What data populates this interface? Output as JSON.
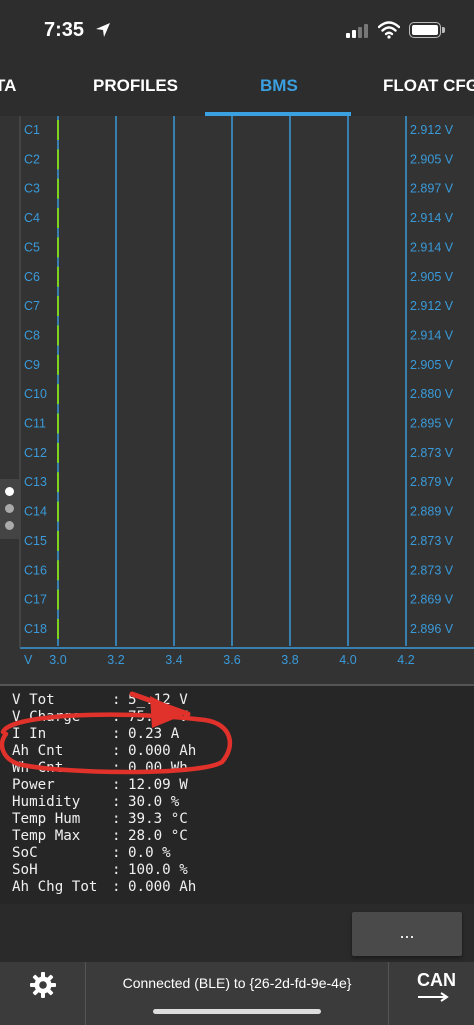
{
  "status_bar": {
    "time": "7:35"
  },
  "tabs": [
    {
      "label": "TA",
      "active": false
    },
    {
      "label": "PROFILES",
      "active": false
    },
    {
      "label": "BMS",
      "active": true
    },
    {
      "label": "FLOAT CFG",
      "active": false
    }
  ],
  "chart_data": {
    "type": "bar",
    "orientation": "horizontal",
    "categories": [
      "C1",
      "C2",
      "C3",
      "C4",
      "C5",
      "C6",
      "C7",
      "C8",
      "C9",
      "C10",
      "C11",
      "C12",
      "C13",
      "C14",
      "C15",
      "C16",
      "C17",
      "C18"
    ],
    "values": [
      2.912,
      2.905,
      2.897,
      2.914,
      2.914,
      2.905,
      2.912,
      2.914,
      2.905,
      2.88,
      2.895,
      2.873,
      2.879,
      2.889,
      2.873,
      2.873,
      2.869,
      2.896
    ],
    "value_labels": [
      "2.912 V",
      "2.905 V",
      "2.897 V",
      "2.914 V",
      "2.914 V",
      "2.905 V",
      "2.912 V",
      "2.914 V",
      "2.905 V",
      "2.880 V",
      "2.895 V",
      "2.873 V",
      "2.879 V",
      "2.889 V",
      "2.873 V",
      "2.873 V",
      "2.869 V",
      "2.896 V"
    ],
    "axis_unit_label": "V",
    "x_ticks": [
      "3.0",
      "3.2",
      "3.4",
      "3.6",
      "3.8",
      "4.0",
      "4.2"
    ],
    "xlim": [
      3.0,
      4.2
    ],
    "grid": true,
    "colors": {
      "axis": "#3a9ad9",
      "bar": "#7ed321",
      "label": "#3a9ad9",
      "bg": "#333333"
    }
  },
  "readout": [
    {
      "label": "V Tot",
      "value": "5_.12 V"
    },
    {
      "label": "V Charge",
      "value": "75.80 V"
    },
    {
      "label": "I In",
      "value": "0.23 A"
    },
    {
      "label": "Ah Cnt",
      "value": "0.000 Ah"
    },
    {
      "label": "Wh Cnt",
      "value": "0.00 Wh"
    },
    {
      "label": "Power",
      "value": "12.09 W"
    },
    {
      "label": "Humidity",
      "value": "30.0 %"
    },
    {
      "label": "Temp Hum",
      "value": "39.3 °C"
    },
    {
      "label": "Temp Max",
      "value": "28.0 °C"
    },
    {
      "label": "SoC",
      "value": "0.0 %"
    },
    {
      "label": "SoH",
      "value": "100.0 %"
    },
    {
      "label": "Ah Chg Tot",
      "value": "0.000 Ah"
    }
  ],
  "readout_separator": ":",
  "more_button": {
    "label": "..."
  },
  "bottom_bar": {
    "connection_text": "Connected (BLE) to {26-2d-fd-9e-4e}",
    "can_label": "CAN"
  },
  "colors": {
    "accent": "#3aa0e0",
    "annotation": "#e0312b"
  }
}
